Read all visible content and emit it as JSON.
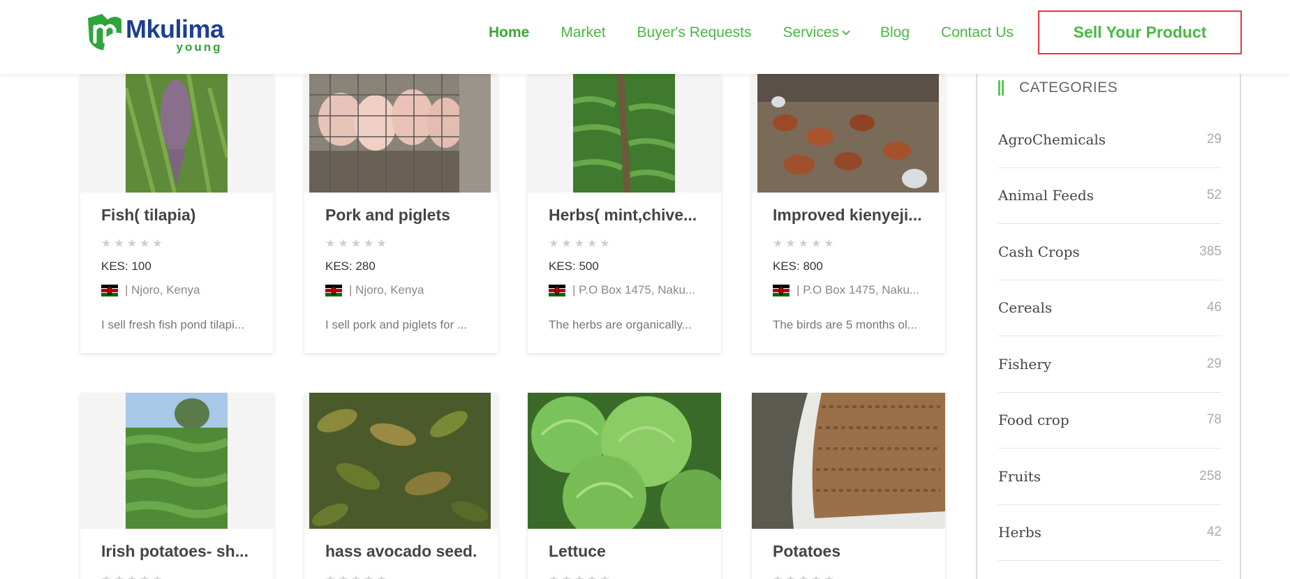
{
  "brand": {
    "name": "Mkulima",
    "tagline": "young"
  },
  "nav": {
    "items": [
      {
        "label": "Home"
      },
      {
        "label": "Market"
      },
      {
        "label": "Buyer's Requests"
      },
      {
        "label": "Services"
      },
      {
        "label": "Blog"
      },
      {
        "label": "Contact Us"
      }
    ],
    "sell_label": "Sell Your Product"
  },
  "products": [
    {
      "title": "Fish( tilapia)",
      "price": "KES: 100",
      "location": "| Njoro, Kenya",
      "desc": "I sell fresh fish pond tilapi...",
      "rating": 0
    },
    {
      "title": "Pork and piglets",
      "price": "KES: 280",
      "location": "| Njoro, Kenya",
      "desc": "I sell pork and piglets for ...",
      "rating": 0
    },
    {
      "title": "Herbs( mint,chive...",
      "price": "KES: 500",
      "location": "| P.O Box 1475, Naku...",
      "desc": "The herbs are organically...",
      "rating": 0
    },
    {
      "title": "Improved kienyeji...",
      "price": "KES: 800",
      "location": "| P.O Box 1475, Naku...",
      "desc": "The birds are 5 months ol...",
      "rating": 0
    },
    {
      "title": "Irish potatoes- sh...",
      "rating": 0
    },
    {
      "title": "hass avocado seed...",
      "rating": 0
    },
    {
      "title": "Lettuce",
      "rating": 0
    },
    {
      "title": "Potatoes",
      "rating": 0
    }
  ],
  "sidebar": {
    "title": "CATEGORIES",
    "categories": [
      {
        "name": "AgroChemicals",
        "count": "29"
      },
      {
        "name": "Animal Feeds",
        "count": "52"
      },
      {
        "name": "Cash Crops",
        "count": "385"
      },
      {
        "name": "Cereals",
        "count": "46"
      },
      {
        "name": "Fishery",
        "count": "29"
      },
      {
        "name": "Food crop",
        "count": "78"
      },
      {
        "name": "Fruits",
        "count": "258"
      },
      {
        "name": "Herbs",
        "count": "42"
      }
    ]
  }
}
